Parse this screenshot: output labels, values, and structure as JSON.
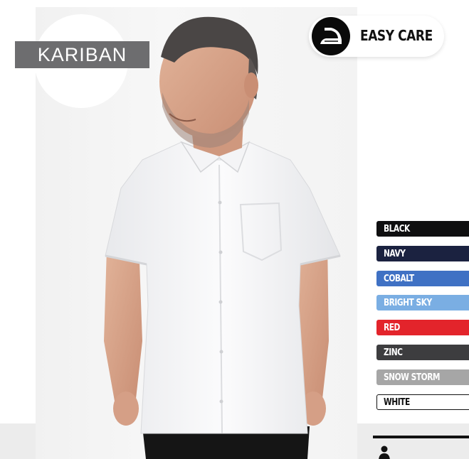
{
  "brand": {
    "logo_text": "KARIBAN"
  },
  "feature_badge": {
    "icon": "iron-icon",
    "label": "EASY CARE"
  },
  "colors": [
    {
      "name": "BLACK",
      "swatch": "#0f0f10",
      "text": "#ffffff",
      "border": "#0f0f10"
    },
    {
      "name": "NAVY",
      "swatch": "#1b2240",
      "text": "#ffffff",
      "border": "#1b2240"
    },
    {
      "name": "COBALT",
      "swatch": "#3f71c4",
      "text": "#ffffff",
      "border": "#3f71c4"
    },
    {
      "name": "BRIGHT SKY",
      "swatch": "#7aaee3",
      "text": "#ffffff",
      "border": "#7aaee3"
    },
    {
      "name": "RED",
      "swatch": "#e3242b",
      "text": "#ffffff",
      "border": "#e3242b"
    },
    {
      "name": "ZINC",
      "swatch": "#3d3d3f",
      "text": "#ffffff",
      "border": "#3d3d3f"
    },
    {
      "name": "SNOW STORM",
      "swatch": "#a6a6a6",
      "text": "#ffffff",
      "border": "#a6a6a6"
    },
    {
      "name": "WHITE",
      "swatch": "#ffffff",
      "text": "#111111",
      "border": "#111111"
    }
  ],
  "footer": {
    "icon": "person-icon"
  }
}
